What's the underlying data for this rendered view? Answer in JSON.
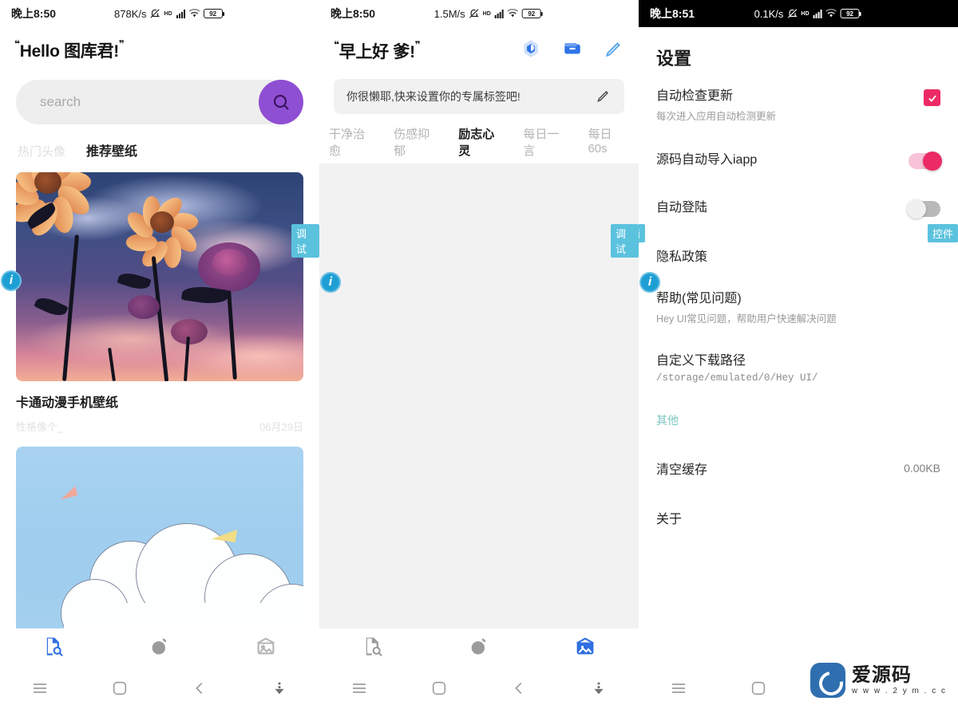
{
  "left": {
    "status": {
      "time": "晚上8:50",
      "speed": "878K/s",
      "hd": "HD",
      "battery": "92"
    },
    "greeting_prefix": "❝",
    "greeting": "Hello 图库君!",
    "greeting_suffix": "❞",
    "search": {
      "placeholder": "search",
      "icon": "search-icon"
    },
    "tabs": [
      {
        "label": "热门头像",
        "active": false
      },
      {
        "label": "推荐壁纸",
        "active": true
      }
    ],
    "cards": [
      {
        "title": "卡通动漫手机壁纸",
        "author": "性格像个_",
        "date": "06月29日",
        "art": "sunset-sunflowers"
      },
      {
        "title": "",
        "author": "",
        "date": "",
        "art": "sky-clouds"
      }
    ],
    "nav": [
      {
        "icon": "document-search-icon",
        "active": true
      },
      {
        "icon": "avatar-icon",
        "active": false
      },
      {
        "icon": "picture-icon",
        "active": false
      }
    ]
  },
  "middle": {
    "status": {
      "time": "晚上8:50",
      "speed": "1.5M/s",
      "hd": "HD",
      "battery": "92"
    },
    "greeting_prefix": "❝",
    "greeting": "早上好 爹!",
    "greeting_suffix": "❞",
    "header_icons": [
      {
        "name": "gem-icon"
      },
      {
        "name": "wallet-icon"
      },
      {
        "name": "pencil-icon"
      }
    ],
    "tag_banner": {
      "text": "你很懒耶,快来设置你的专属标签吧!",
      "icon": "edit-icon"
    },
    "tabs": [
      {
        "label": "干净治愈",
        "active": false
      },
      {
        "label": "伤感抑郁",
        "active": false
      },
      {
        "label": "励志心灵",
        "active": true
      },
      {
        "label": "每日一言",
        "active": false
      },
      {
        "label": "每日60s",
        "active": false
      }
    ],
    "nav": [
      {
        "icon": "document-search-icon",
        "active": false
      },
      {
        "icon": "avatar-icon",
        "active": false
      },
      {
        "icon": "picture-icon",
        "active": true
      }
    ]
  },
  "right": {
    "status": {
      "time": "晚上8:51",
      "speed": "0.1K/s",
      "hd": "HD",
      "battery": "92"
    },
    "title": "设置",
    "rows": [
      {
        "label": "自动检查更新",
        "sub": "每次进入应用自动检测更新",
        "control": "checkbox",
        "state": "checked"
      },
      {
        "label": "源码自动导入iapp",
        "sub": "",
        "control": "switch",
        "state": "on"
      },
      {
        "label": "自动登陆",
        "sub": "",
        "control": "switch",
        "state": "off"
      },
      {
        "label": "隐私政策",
        "sub": "",
        "control": "none",
        "state": ""
      },
      {
        "label": "帮助(常见问题)",
        "sub": "Hey UI常见问题，帮助用户快速解决问题",
        "control": "none",
        "state": ""
      },
      {
        "label": "自定义下载路径",
        "sub": "/storage/emulated/0/Hey UI/",
        "sub_mono": true,
        "control": "none",
        "state": ""
      },
      {
        "label": "其他",
        "sub": "",
        "control": "section",
        "state": ""
      },
      {
        "label": "清空缓存",
        "sub": "",
        "control": "value",
        "value": "0.00KB"
      },
      {
        "label": "关于",
        "sub": "",
        "control": "none",
        "state": ""
      }
    ]
  },
  "sysnav": [
    {
      "icon": "menu-icon"
    },
    {
      "icon": "home-icon"
    },
    {
      "icon": "back-icon"
    },
    {
      "icon": "download-icon"
    }
  ],
  "overlays": {
    "badges": [
      {
        "label": "调试",
        "panel": "left"
      },
      {
        "label": "调试",
        "panel": "middle"
      },
      {
        "label": "界面",
        "panel": "middle"
      },
      {
        "label": "控件",
        "panel": "right"
      }
    ],
    "info_icons": [
      "info-icon",
      "info-icon",
      "info-icon"
    ]
  },
  "watermark": {
    "name": "爱源码",
    "url": "w w w . 2 y m . c c"
  },
  "colors": {
    "accent_purple": "#8F4FD3",
    "accent_pink": "#EC2A66",
    "badge_blue": "#5BC2DE",
    "info_blue": "#1E9FD4",
    "nav_active_blue": "#2F6FE0"
  }
}
